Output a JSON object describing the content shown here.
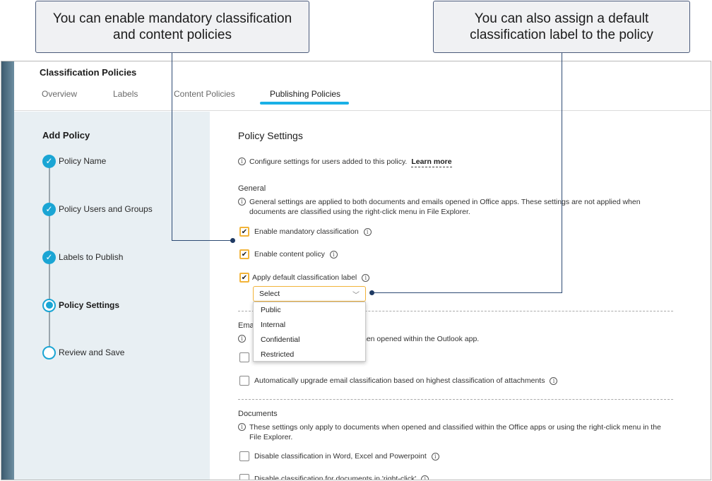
{
  "callouts": {
    "left": "You can enable mandatory classification and content policies",
    "right": "You can also assign a default classification label to the policy"
  },
  "header": {
    "title": "Classification Policies",
    "tabs": [
      "Overview",
      "Labels",
      "Content Policies",
      "Publishing Policies"
    ],
    "active_tab": "Publishing Policies"
  },
  "sidebar": {
    "title": "Add Policy",
    "steps": [
      {
        "label": "Policy Name",
        "state": "done"
      },
      {
        "label": "Policy Users and Groups",
        "state": "done"
      },
      {
        "label": "Labels to Publish",
        "state": "done"
      },
      {
        "label": "Policy Settings",
        "state": "current"
      },
      {
        "label": "Review and Save",
        "state": "todo"
      }
    ]
  },
  "main": {
    "title": "Policy Settings",
    "intro": "Configure settings for users added to this policy.",
    "learn_more": "Learn more",
    "general": {
      "heading": "General",
      "info": "General settings are applied to both documents and emails opened in Office apps. These settings are not applied when documents are classified using the right-click menu in File Explorer.",
      "options": [
        {
          "label": "Enable mandatory classification",
          "checked": true
        },
        {
          "label": "Enable content policy",
          "checked": true
        },
        {
          "label": "Apply default classification label",
          "checked": true
        }
      ],
      "select_value": "Select",
      "dropdown_options": [
        "Public",
        "Internal",
        "Confidential",
        "Restricted"
      ]
    },
    "email": {
      "heading_visible": "Emai",
      "info_visible": "hen opened within the Outlook app.",
      "auto_upgrade": "Automatically upgrade email classification based on highest classification of attachments"
    },
    "documents": {
      "heading": "Documents",
      "info": "These settings only apply to documents when opened and classified within the Office apps or using the right-click menu in the File Explorer.",
      "options": [
        {
          "label": "Disable classification in Word, Excel and Powerpoint",
          "checked": false
        },
        {
          "label": "Disable classification for documents in 'right-click'",
          "checked": false
        }
      ]
    }
  },
  "colors": {
    "accent": "#1aa5d4",
    "checkbox_highlight": "#f2b43a",
    "callout_border": "#4a5a7a"
  }
}
